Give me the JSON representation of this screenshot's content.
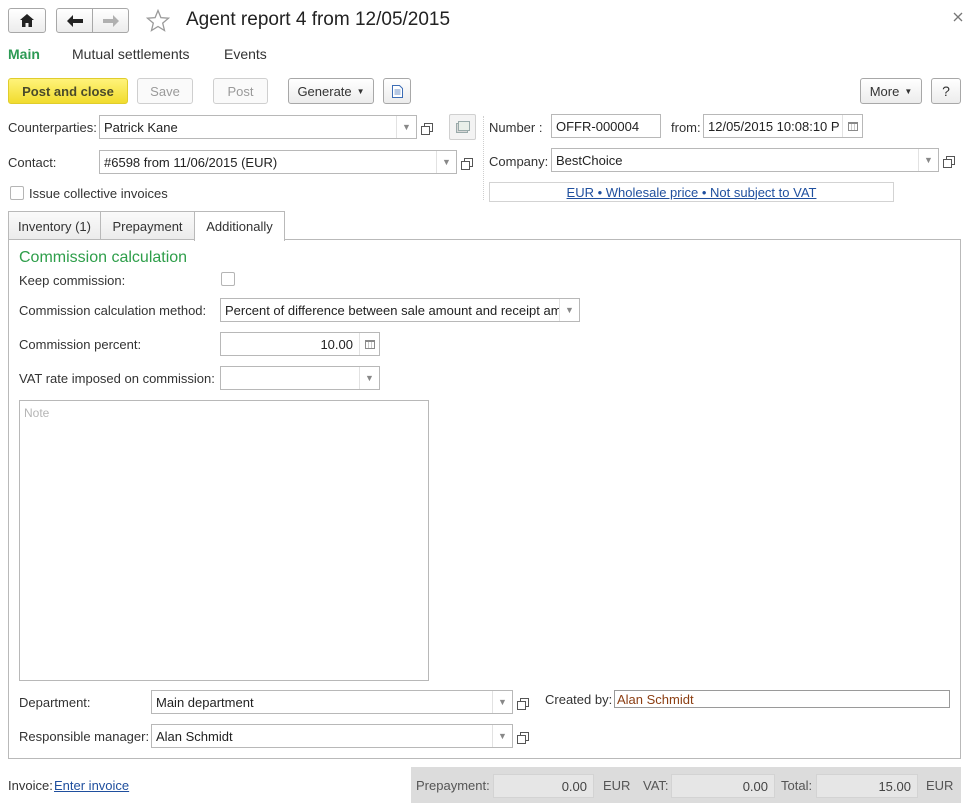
{
  "window": {
    "title": "Agent report 4 from 12/05/2015"
  },
  "nav_tabs": [
    "Main",
    "Mutual settlements",
    "Events"
  ],
  "toolbar": {
    "post_and_close": "Post and close",
    "save": "Save",
    "post": "Post",
    "generate": "Generate",
    "more": "More",
    "help": "?"
  },
  "header": {
    "counterparties_label": "Counterparties:",
    "counterparties_value": "Patrick Kane",
    "contact_label": "Contact:",
    "contact_value": "#6598 from 11/06/2015 (EUR)",
    "issue_collective_label": "Issue collective invoices",
    "number_label": "Number :",
    "number_value": "OFFR-000004",
    "from_label": "from:",
    "from_value": "12/05/2015 10:08:10 P",
    "company_label": "Company:",
    "company_value": "BestChoice",
    "price_link": "EUR • Wholesale price • Not subject to VAT"
  },
  "doc_tabs": [
    "Inventory (1)",
    "Prepayment",
    "Additionally"
  ],
  "additionally": {
    "section_title": "Commission calculation",
    "keep_commission_label": "Keep commission:",
    "method_label": "Commission calculation method:",
    "method_value": "Percent of difference between sale amount and receipt amount",
    "percent_label": "Commission percent:",
    "percent_value": "10.00",
    "vat_rate_label": "VAT rate imposed on commission:",
    "vat_rate_value": "",
    "note_placeholder": "Note",
    "department_label": "Department:",
    "department_value": "Main department",
    "manager_label": "Responsible manager:",
    "manager_value": "Alan Schmidt",
    "created_by_label": "Created by:",
    "created_by_value": "Alan Schmidt"
  },
  "footer": {
    "invoice_label": "Invoice:",
    "invoice_link": "Enter invoice",
    "prepayment_label": "Prepayment:",
    "prepayment_value": "0.00",
    "prepayment_currency": "EUR",
    "vat_label": "VAT:",
    "vat_value": "0.00",
    "total_label": "Total:",
    "total_value": "15.00",
    "total_currency": "EUR"
  },
  "colors": {
    "accent_green": "#2c9a54",
    "section_green": "#2e9e4a",
    "link_blue": "#1f4f9e",
    "primary_yellow": "#f4e04a",
    "created_by_text": "#8b3e12"
  },
  "icons": [
    "home-icon",
    "back-arrow-icon",
    "forward-arrow-icon",
    "star-icon",
    "close-icon",
    "document-icon",
    "calendar-icon",
    "open-icon",
    "select-icon"
  ]
}
